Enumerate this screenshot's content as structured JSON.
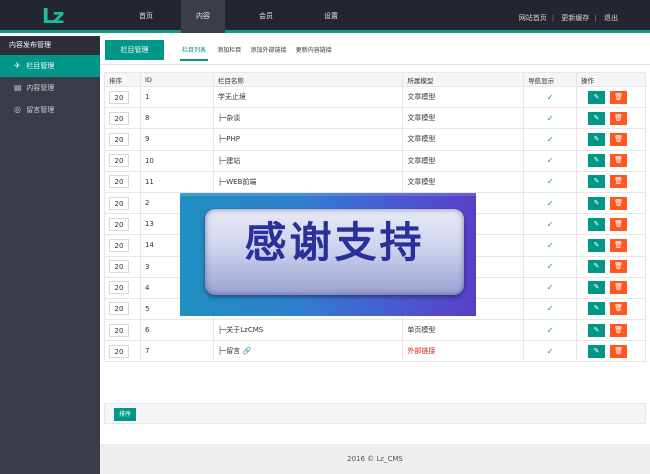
{
  "topbar": {
    "logo": "Lz",
    "nav": [
      {
        "label": "首页",
        "active": false
      },
      {
        "label": "内容",
        "active": true
      },
      {
        "label": "会员",
        "active": false
      },
      {
        "label": "设置",
        "active": false
      }
    ],
    "links": [
      "网站首页",
      "更新缓存",
      "退出"
    ]
  },
  "sidebar": {
    "header": "内容发布管理",
    "items": [
      {
        "label": "栏目管理",
        "icon": "paper-plane-icon",
        "active": true
      },
      {
        "label": "内容管理",
        "icon": "document-icon",
        "active": false
      },
      {
        "label": "留言管理",
        "icon": "chat-icon",
        "active": false
      }
    ]
  },
  "main": {
    "page_title": "栏目管理",
    "subtabs": [
      {
        "label": "栏目列表",
        "active": true
      },
      {
        "label": "添加栏目",
        "active": false
      },
      {
        "label": "添加外部链接",
        "active": false
      },
      {
        "label": "更新内容链接",
        "active": false
      }
    ],
    "table": {
      "headers": [
        "排序",
        "ID",
        "栏目名称",
        "所属模型",
        "导航显示",
        "操作"
      ],
      "rows": [
        {
          "sort": "20",
          "id": "1",
          "name": "学无止境",
          "model": "文章模型",
          "nav": true
        },
        {
          "sort": "20",
          "id": "8",
          "name": "├─杂谈",
          "model": "文章模型",
          "nav": true
        },
        {
          "sort": "20",
          "id": "9",
          "name": "├─PHP",
          "model": "文章模型",
          "nav": true
        },
        {
          "sort": "20",
          "id": "10",
          "name": "├─建站",
          "model": "文章模型",
          "nav": true
        },
        {
          "sort": "20",
          "id": "11",
          "name": "├─WEB前端",
          "model": "文章模型",
          "nav": true
        },
        {
          "sort": "20",
          "id": "2",
          "name": "",
          "model": "",
          "nav": true
        },
        {
          "sort": "20",
          "id": "13",
          "name": "",
          "model": "",
          "nav": true
        },
        {
          "sort": "20",
          "id": "14",
          "name": "",
          "model": "",
          "nav": true
        },
        {
          "sort": "20",
          "id": "3",
          "name": "",
          "model": "",
          "nav": true
        },
        {
          "sort": "20",
          "id": "4",
          "name": "",
          "model": "",
          "nav": true
        },
        {
          "sort": "20",
          "id": "5",
          "name": "",
          "model": "",
          "nav": true
        },
        {
          "sort": "20",
          "id": "6",
          "name": "├─关于LzCMS",
          "model": "单页模型",
          "nav": true
        },
        {
          "sort": "20",
          "id": "7",
          "name": "├─留言",
          "model": "外部链接",
          "nav": true,
          "link_icon": true,
          "model_color": "#e22222"
        }
      ],
      "edit_icon": "pencil-icon",
      "delete_icon": "trash-icon",
      "check_icon": "check-icon"
    },
    "sort_button": "排序"
  },
  "overlay": {
    "text": "感谢支持"
  },
  "footer": {
    "text": "2016 ©  Lz_CMS"
  },
  "colors": {
    "accent": "#009688",
    "danger": "#ff5722",
    "topbar": "#23262e",
    "sidebar": "#393d49"
  }
}
